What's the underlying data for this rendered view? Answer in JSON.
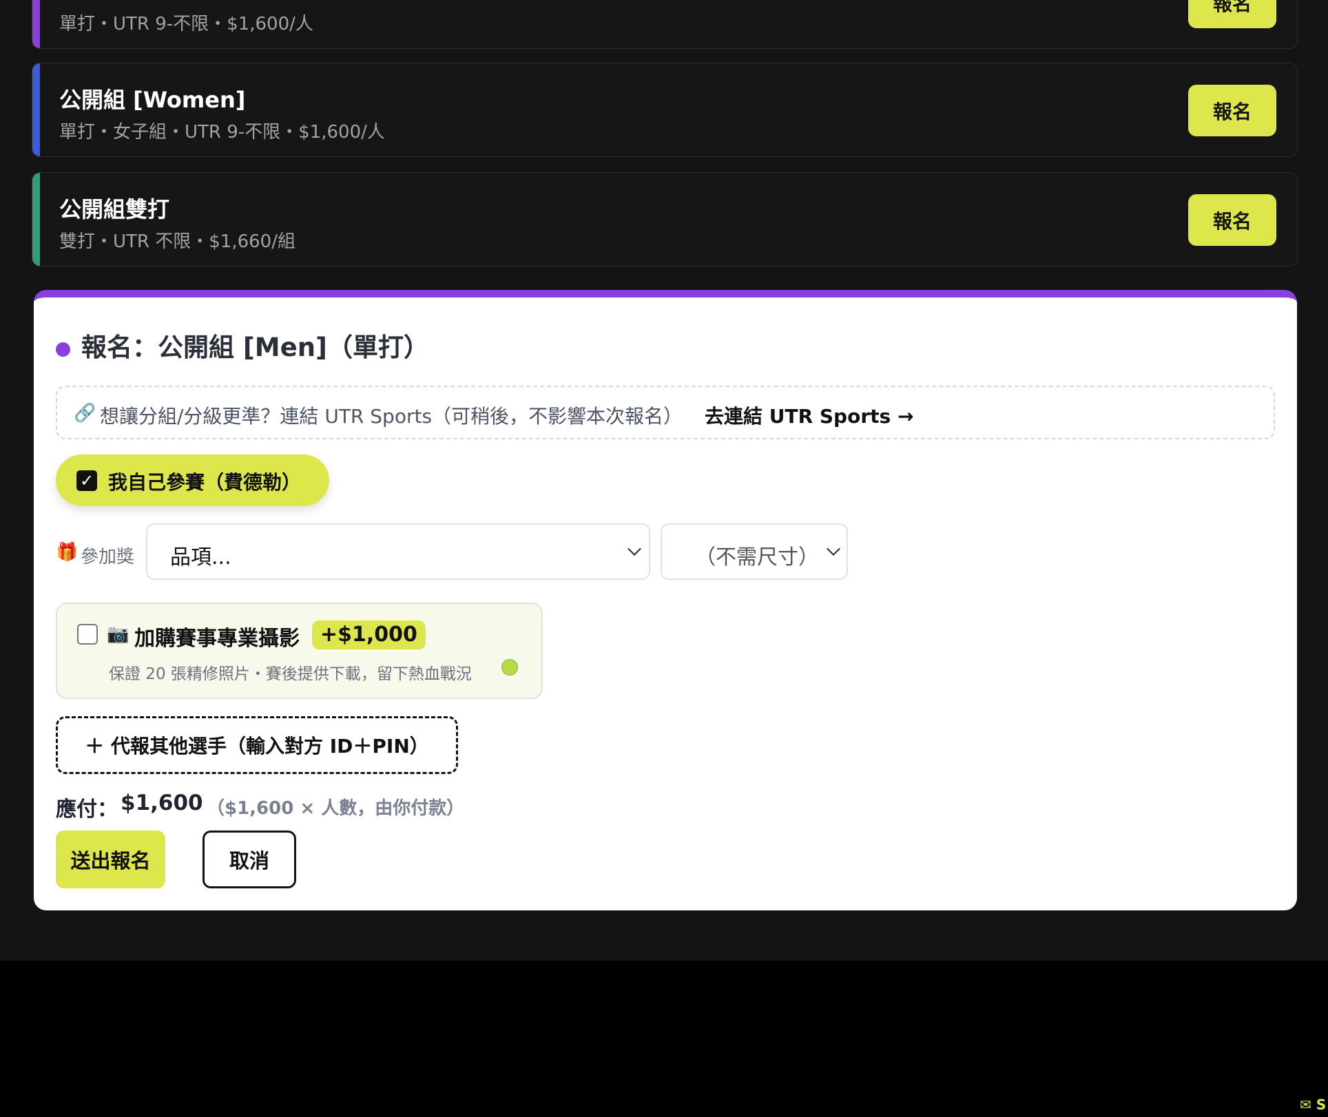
{
  "events": [
    {
      "title": "",
      "meta": "單打・UTR 9-不限・$1,600/人",
      "button": "報名",
      "accent": "#8b3fe0"
    },
    {
      "title": "公開組 [Women]",
      "meta": "單打・女子組・UTR 9-不限・$1,600/人",
      "button": "報名",
      "accent": "#3b5bdb"
    },
    {
      "title": "公開組雙打",
      "meta": "雙打・UTR 不限・$1,660/組",
      "button": "報名",
      "accent": "#2f9e7a"
    }
  ],
  "form": {
    "accent": "#8b3fe0",
    "title": "報名：公開組 [Men]（單打）",
    "utr": {
      "icon": "link-icon",
      "text": "想讓分組/分級更準？連結 UTR Sports（可稍後，不影響本次報名）",
      "link": "去連結 UTR Sports →"
    },
    "self_entry": {
      "label": "我自己參賽（費德勒）",
      "checked": true
    },
    "prize": {
      "icon": "gift-icon",
      "label": "參加獎",
      "item_select": "品項...",
      "size_select": "（不需尺寸）"
    },
    "photo_addon": {
      "icon": "camera-icon",
      "label": "加購賽事專業攝影",
      "price": "+$1,000",
      "description": "保證 20 張精修照片・賽後提供下載，留下熱血戰況",
      "checked": false
    },
    "proxy_button": "＋ 代報其他選手（輸入對方 ID＋PIN）",
    "total": {
      "label": "應付：",
      "amount": "$1,600",
      "note": "（$1,600 × 人數，由你付款）"
    },
    "submit_button": "送出報名",
    "cancel_button": "取消"
  },
  "corner_mark": "✉ S",
  "colors": {
    "brand_yellow": "#dde74c",
    "purple": "#8b3fe0",
    "background": "#141414"
  }
}
